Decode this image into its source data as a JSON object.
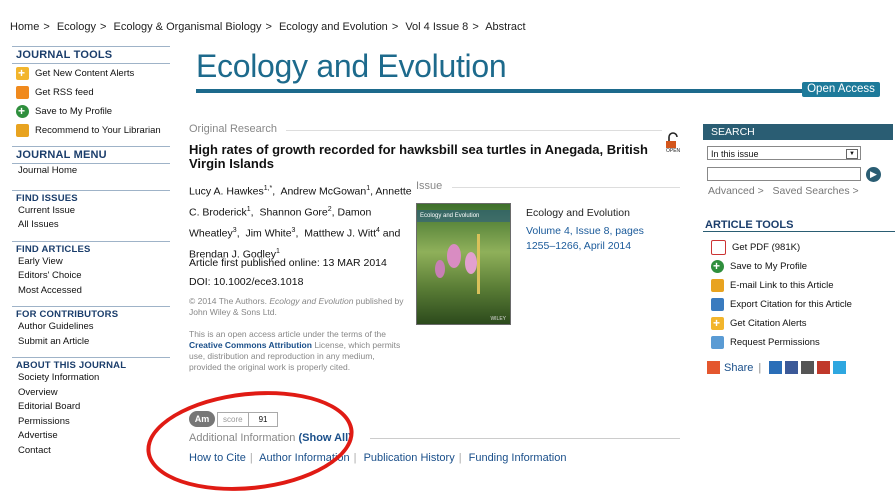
{
  "breadcrumb": [
    "Home",
    "Ecology",
    "Ecology & Organismal Biology",
    "Ecology and Evolution",
    "Vol 4 Issue 8",
    "Abstract"
  ],
  "breadcrumb_sep": ">",
  "journal_tools": {
    "heading": "JOURNAL TOOLS",
    "items": [
      {
        "label": "Get New Content Alerts",
        "icon": "alert-plus-icon"
      },
      {
        "label": "Get RSS feed",
        "icon": "rss-icon"
      },
      {
        "label": "Save to My Profile",
        "icon": "save-plus-icon"
      },
      {
        "label": "Recommend to Your Librarian",
        "icon": "envelope-icon"
      }
    ]
  },
  "journal_menu": {
    "heading": "JOURNAL MENU",
    "items": [
      "Journal Home"
    ]
  },
  "find_issues": {
    "heading": "FIND ISSUES",
    "items": [
      "Current Issue",
      "All Issues"
    ]
  },
  "find_articles": {
    "heading": "FIND ARTICLES",
    "items": [
      "Early View",
      "Editors' Choice",
      "Most Accessed"
    ]
  },
  "for_contributors": {
    "heading": "FOR CONTRIBUTORS",
    "items": [
      "Author Guidelines",
      "Submit an Article"
    ]
  },
  "about_journal": {
    "heading": "ABOUT THIS JOURNAL",
    "items": [
      "Society Information",
      "Overview",
      "Editorial Board",
      "Permissions",
      "Advertise",
      "Contact"
    ]
  },
  "journal_title": "Ecology and Evolution",
  "open_access_badge": "Open Access",
  "article": {
    "section": "Original Research",
    "title": "High rates of growth recorded for hawksbill sea turtles in Anegada, British Virgin Islands",
    "open_icon_label": "OPEN",
    "authors": [
      {
        "name": "Lucy A. Hawkes",
        "sup": "1,*"
      },
      {
        "name": "Andrew McGowan",
        "sup": "1"
      },
      {
        "name": "Annette C. Broderick",
        "sup": "1"
      },
      {
        "name": "Shannon Gore",
        "sup": "2"
      },
      {
        "name": "Damon Wheatley",
        "sup": "3"
      },
      {
        "name": "Jim White",
        "sup": "3"
      },
      {
        "name": "Matthew J. Witt",
        "sup": "4"
      },
      {
        "name": "Brendan J. Godley",
        "sup": "1"
      }
    ],
    "published": "Article first published online: 13 MAR 2014",
    "doi": "DOI: 10.1002/ece3.1018",
    "copyright_prefix": "© 2014 The Authors. ",
    "copyright_journal": "Ecology and Evolution",
    "copyright_suffix": " published by John Wiley & Sons Ltd.",
    "license_prefix": "This is an open access article under the terms of the ",
    "license_link": "Creative Commons Attribution",
    "license_suffix": " License, which permits use, distribution and reproduction in any medium, provided the original work is properly cited."
  },
  "issue": {
    "label": "Issue",
    "cover_band": "Ecology and Evolution",
    "cover_publisher": "WILEY",
    "journal": "Ecology and Evolution",
    "volume_pages": "Volume 4, Issue 8, pages 1255–1266, April 2014"
  },
  "altmetric": {
    "badge": "Am",
    "label": "score",
    "value": "91"
  },
  "additional_info": {
    "label": "Additional Information",
    "show_all": "(Show All)"
  },
  "info_tabs": [
    "How to Cite",
    "Author Information",
    "Publication History",
    "Funding Information"
  ],
  "search": {
    "heading": "SEARCH",
    "scope": "In this issue",
    "advanced": "Advanced >",
    "saved": "Saved Searches >"
  },
  "article_tools": {
    "heading": "ARTICLE TOOLS",
    "items": [
      {
        "label": "Get PDF (981K)",
        "icon": "pdf-icon"
      },
      {
        "label": "Save to My Profile",
        "icon": "save-plus-icon"
      },
      {
        "label": "E-mail Link to this Article",
        "icon": "envelope-icon"
      },
      {
        "label": "Export Citation for this Article",
        "icon": "export-citation-icon"
      },
      {
        "label": "Get Citation Alerts",
        "icon": "alert-plus-icon"
      },
      {
        "label": "Request Permissions",
        "icon": "permissions-icon"
      }
    ]
  },
  "share": {
    "label": "Share",
    "separator": "|"
  },
  "colors": {
    "brand": "#1d6a8c",
    "panel": "#2a5d73",
    "link": "#1a4f8a",
    "highlight_oval": "#e01b14"
  }
}
